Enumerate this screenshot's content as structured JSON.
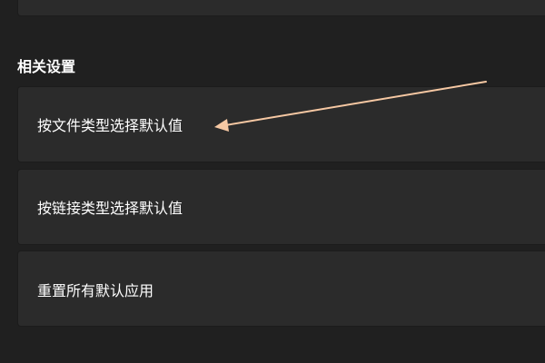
{
  "section": {
    "title": "相关设置"
  },
  "settings": {
    "items": [
      {
        "label": "按文件类型选择默认值"
      },
      {
        "label": "按链接类型选择默认值"
      },
      {
        "label": "重置所有默认应用"
      }
    ]
  },
  "colors": {
    "background": "#202020",
    "card": "#2b2b2b",
    "text": "#ffffff",
    "annotation_arrow": "#f6c8a3"
  },
  "icons": {
    "annotation": "arrow-pointer-icon"
  }
}
